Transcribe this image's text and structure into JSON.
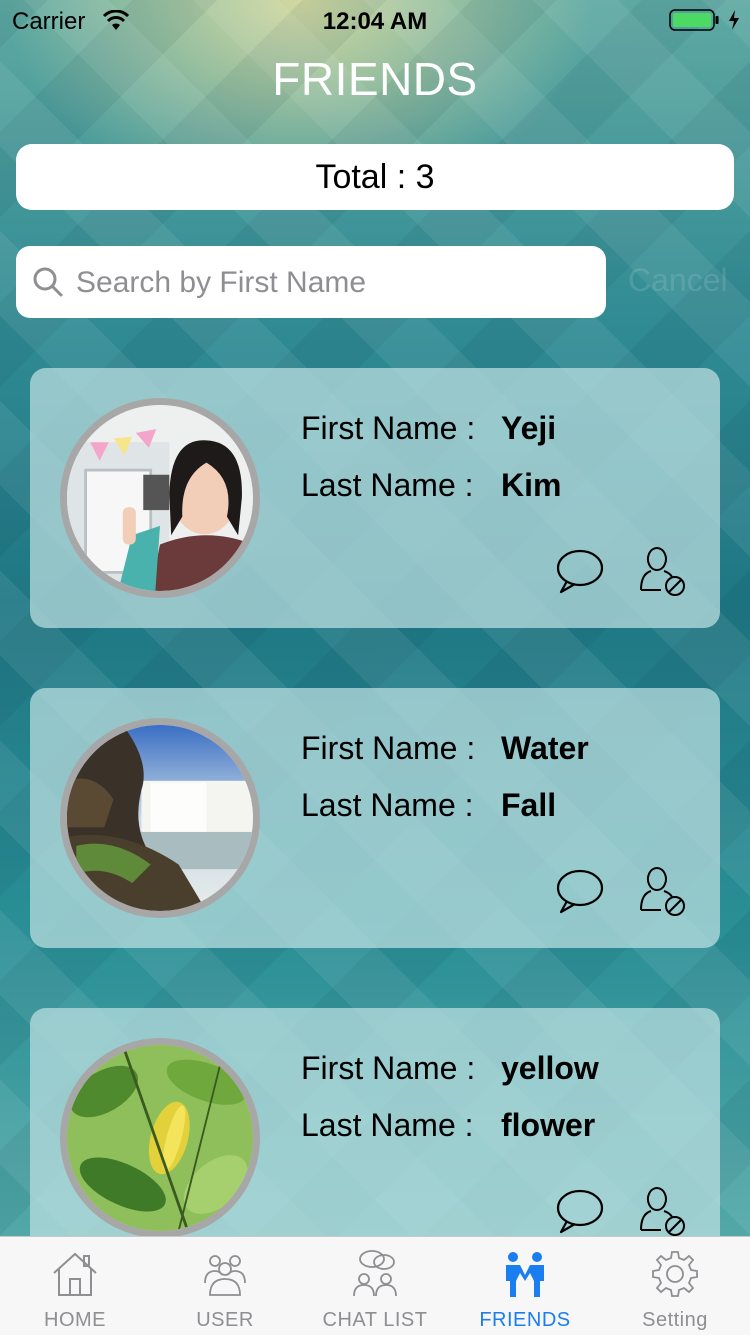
{
  "status_bar": {
    "carrier": "Carrier",
    "time": "12:04 AM"
  },
  "header": {
    "title": "FRIENDS"
  },
  "total": {
    "text": "Total : 3"
  },
  "search": {
    "placeholder": "Search by First Name",
    "value": "",
    "cancel_label": "Cancel"
  },
  "friends": [
    {
      "first_label": "First Name :",
      "first": "Yeji",
      "last_label": "Last Name :",
      "last": "Kim"
    },
    {
      "first_label": "First Name :",
      "first": "Water",
      "last_label": "Last Name :",
      "last": "Fall"
    },
    {
      "first_label": "First Name :",
      "first": "yellow",
      "last_label": "Last Name :",
      "last": "flower"
    }
  ],
  "tabs": [
    {
      "label": "HOME",
      "icon": "home-icon"
    },
    {
      "label": "USER",
      "icon": "users-icon"
    },
    {
      "label": "CHAT LIST",
      "icon": "chat-list-icon"
    },
    {
      "label": "FRIENDS",
      "icon": "friends-icon",
      "active": true
    },
    {
      "label": "Setting",
      "icon": "gear-icon"
    }
  ],
  "colors": {
    "accent": "#1a7df0",
    "inactive": "#8e8e93",
    "battery": "#4cd964"
  }
}
